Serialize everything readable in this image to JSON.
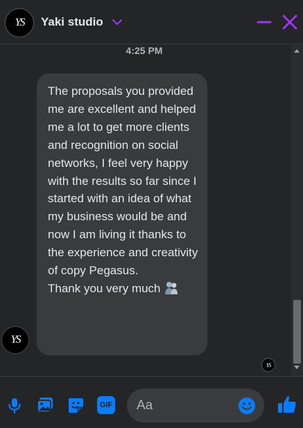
{
  "header": {
    "avatar_text": "YS",
    "title": "Yaki studio",
    "icons": {
      "dropdown": "chevron-down-icon",
      "minimize": "minimize-icon",
      "close": "close-icon"
    }
  },
  "conversation": {
    "timestamp": "4:25 PM",
    "message": {
      "body": "The proposals you provided me are excellent and helped me a lot to get more clients and recognition on social networks, I feel very happy with the results so far since I started with an idea of what my business would be and now I am living it thanks to the experience and creativity of copy Pegasus.",
      "closing": "Thank you very much",
      "emoji": "hugging-people-icon"
    },
    "sender_avatar_text": "YS",
    "seen_avatar_text": "YS"
  },
  "composer": {
    "placeholder": "Aa",
    "icons": [
      "microphone-icon",
      "image-icon",
      "sticker-icon",
      "gif-icon",
      "emoji-icon",
      "like-icon"
    ],
    "gif_label": "GIF"
  },
  "colors": {
    "accent": "#a033ff",
    "messenger_blue": "#0a7cff",
    "bubble": "#3a3b3c",
    "background": "#242526"
  }
}
